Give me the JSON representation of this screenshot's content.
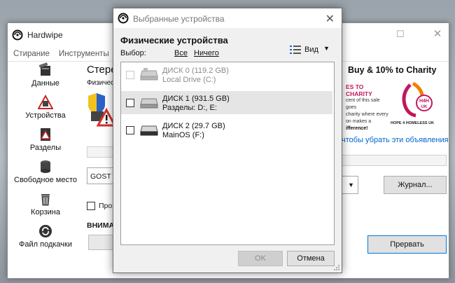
{
  "main_window": {
    "title": "Hardwipe",
    "menu": [
      "Стирание",
      "Инструменты"
    ],
    "sidebar": [
      {
        "label": "Данные",
        "icon": "data-wipe-icon"
      },
      {
        "label": "Устройства",
        "icon": "device-warning-icon"
      },
      {
        "label": "Разделы",
        "icon": "partition-icon"
      },
      {
        "label": "Свободное место",
        "icon": "free-space-icon"
      },
      {
        "label": "Корзина",
        "icon": "recycle-bin-icon"
      },
      {
        "label": "Файл подкачки",
        "icon": "swap-file-icon"
      }
    ],
    "content": {
      "heading": "Стере",
      "sub": "Физичес",
      "method": "GOST R",
      "checkbox": "Прове",
      "warning": "ВНИМА"
    },
    "ad": {
      "headline": "Buy & 10% to Charity",
      "text_lines": [
        "ES TO CHARITY",
        "cent of this sale goes",
        "charity where every",
        "on makes a",
        "ifference!"
      ],
      "org": "HOPE 4 HOMELESS UK",
      "badge": "H4H UK",
      "link": "чтобы убрать эти объявления"
    },
    "buttons": {
      "journal": "Журнал...",
      "abort": "Прервать"
    }
  },
  "dialog": {
    "title": "Выбранные устройства",
    "section": "Физические устройства",
    "select_label": "Выбор:",
    "select_all": "Все",
    "select_none": "Ничего",
    "view_label": "Вид",
    "devices": [
      {
        "name": "ДИСК 0 (119.2 GB)",
        "sub": "Local Drive (C:)",
        "checked": false,
        "disabled": true,
        "highlighted": false
      },
      {
        "name": "ДИСК 1 (931.5 GB)",
        "sub": "Разделы: D:, E:",
        "checked": false,
        "disabled": false,
        "highlighted": true
      },
      {
        "name": "ДИСК 2 (29.7 GB)",
        "sub": "MainOS (F:)",
        "checked": false,
        "disabled": false,
        "highlighted": false
      }
    ],
    "ok_label": "OK",
    "cancel_label": "Отмена"
  },
  "colors": {
    "accent_blue": "#0078d7",
    "ad_magenta": "#c2185b",
    "link_blue": "#0066cc"
  }
}
